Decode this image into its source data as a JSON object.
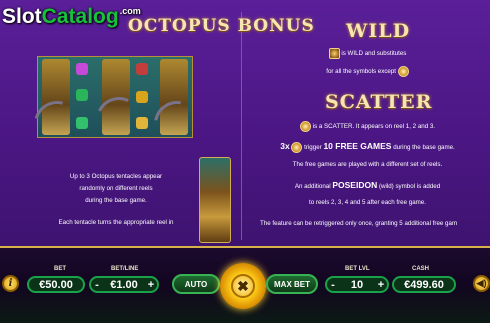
{
  "watermark": {
    "brand_part1": "Slot",
    "brand_part2": "Catalog",
    "domain": ".com"
  },
  "bonus": {
    "title": "OCTOPUS BONUS",
    "lines": [
      "Up to 3 Octopus tentacles appear",
      "randomly on different reels",
      "during the base game.",
      "Each tentacle turns the appropriate reel in"
    ]
  },
  "wild": {
    "title": "WILD",
    "line1": "is WILD and substitutes",
    "line2": "for all the symbols except"
  },
  "scatter": {
    "title": "SCATTER",
    "line1": "is a SCATTER. It appears on reel 1, 2 and 3.",
    "trigger_prefix": "3x",
    "trigger_text": "trigger",
    "trigger_highlight": "10 FREE GAMES",
    "trigger_suffix": "during the base game.",
    "line3": "The free games are played with a different set of reels.",
    "line4_prefix": "An additional",
    "line4_highlight": "POSEIDON",
    "line4_suffix": "(wild) symbol is added",
    "line5": "to reels 2, 3, 4 and 5 after each free game.",
    "line6": "The feature can be retriggered only once, granting 5 additional free gam"
  },
  "controls": {
    "info_label": "i",
    "bet_label": "BET",
    "bet_value": "€50.00",
    "betline_label": "BET/LINE",
    "betline_minus": "-",
    "betline_value": "€1.00",
    "betline_plus": "+",
    "auto_label": "AUTO",
    "spin_label": "✖",
    "maxbet_label": "MAX BET",
    "betlvl_label": "BET LVL",
    "betlvl_minus": "-",
    "betlvl_value": "10",
    "betlvl_plus": "+",
    "cash_label": "CASH",
    "cash_value": "€499.60",
    "sound_label": "◀)"
  }
}
